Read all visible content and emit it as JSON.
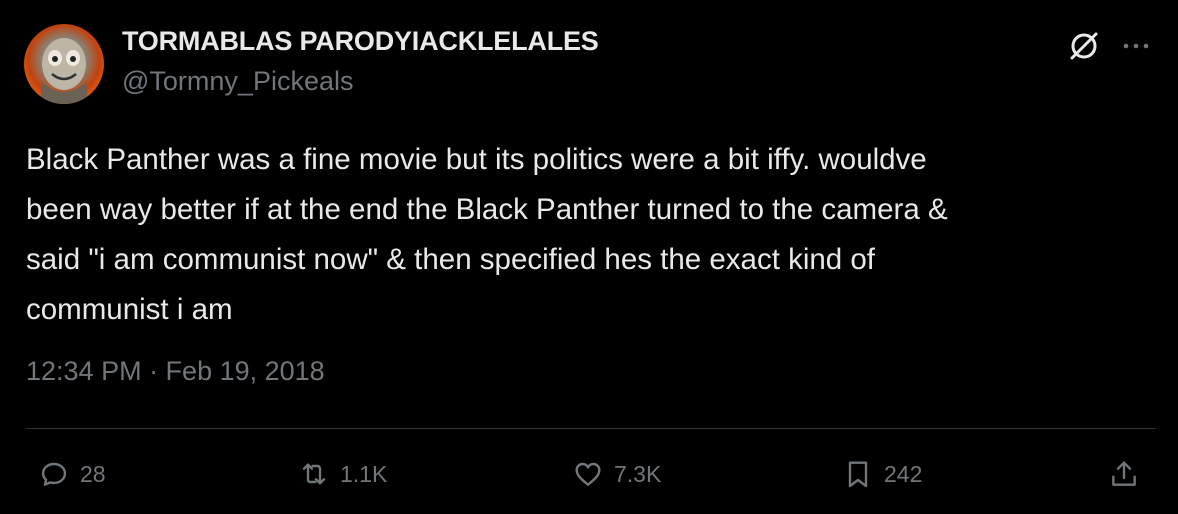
{
  "author": {
    "display_name": "TORMABLAS PARODYIACKLELALES",
    "handle": "@Tormny_Pickeals"
  },
  "tweet": {
    "text": "Black Panther was a fine movie but its politics were a bit iffy. wouldve\nbeen way better if at the end the Black Panther turned to the camera &\nsaid \"i am communist now\" & then specified hes the exact kind of\ncommunist i am",
    "timestamp": "12:34 PM · Feb 19, 2018"
  },
  "actions": {
    "replies": "28",
    "retweets": "1.1K",
    "likes": "7.3K",
    "bookmarks": "242"
  },
  "icons": {
    "top_right": [
      "grok-icon",
      "more-icon"
    ],
    "actions": [
      "reply-icon",
      "retweet-icon",
      "like-icon",
      "bookmark-icon",
      "share-icon"
    ]
  },
  "colors": {
    "background": "#000000",
    "text": "#e7e9ea",
    "secondary_text": "#71767b",
    "divider": "#2f3336"
  }
}
